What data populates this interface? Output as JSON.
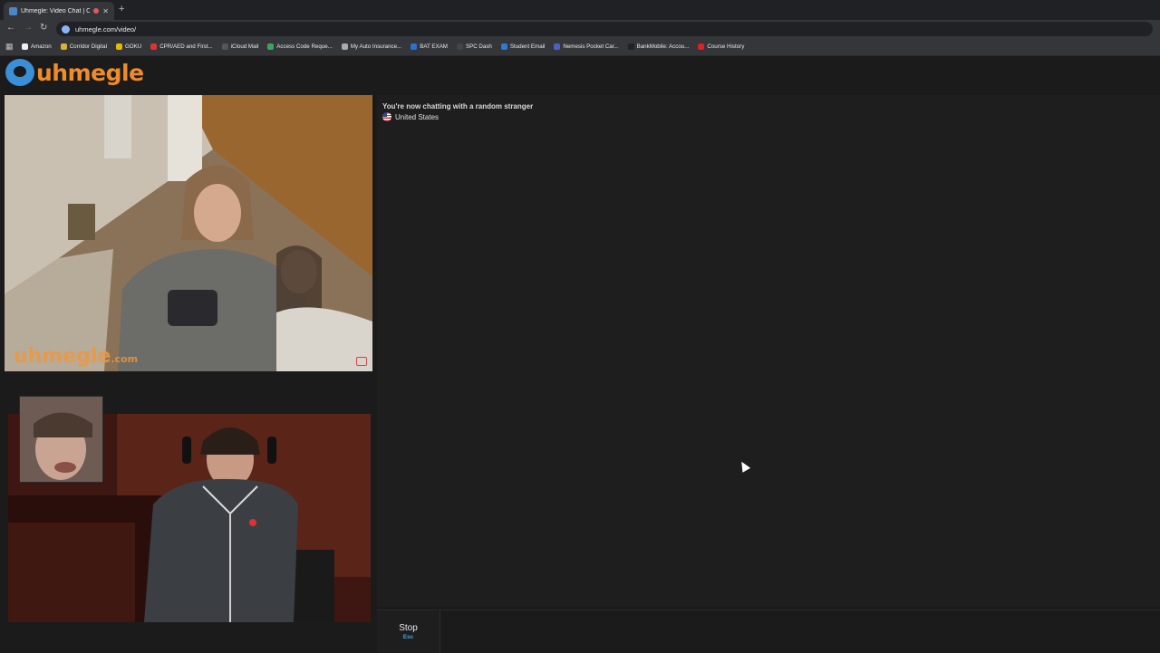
{
  "browser": {
    "tab_title": "Uhmegle: Video Chat | Om...",
    "url": "uhmegle.com/video/",
    "bookmarks": [
      {
        "label": "Amazon",
        "color": "#f0f0f0"
      },
      {
        "label": "Corridor Digital",
        "color": "#d9b23a"
      },
      {
        "label": "GOKU",
        "color": "#e6b800"
      },
      {
        "label": "CPR/AED and First...",
        "color": "#d33"
      },
      {
        "label": "iCloud Mail",
        "color": "#555"
      },
      {
        "label": "Access Code Reque...",
        "color": "#3ba55d"
      },
      {
        "label": "My Auto Insurance...",
        "color": "#aaa"
      },
      {
        "label": "BAT EXAM",
        "color": "#2f6fd1"
      },
      {
        "label": "SPC Dash",
        "color": "#444"
      },
      {
        "label": "Student Email",
        "color": "#2a7ad6"
      },
      {
        "label": "Nemesis Pocket Car...",
        "color": "#4a62c8"
      },
      {
        "label": "BankMobile: Accou...",
        "color": "#222"
      },
      {
        "label": "Course History",
        "color": "#d22"
      }
    ]
  },
  "site": {
    "logo_text": "uhmegle",
    "watermark": "uhmegle",
    "watermark_domain": ".com"
  },
  "chat": {
    "status": "You're now chatting with a random stranger",
    "country": "United States"
  },
  "controls": {
    "stop_label": "Stop",
    "stop_key": "Esc"
  }
}
